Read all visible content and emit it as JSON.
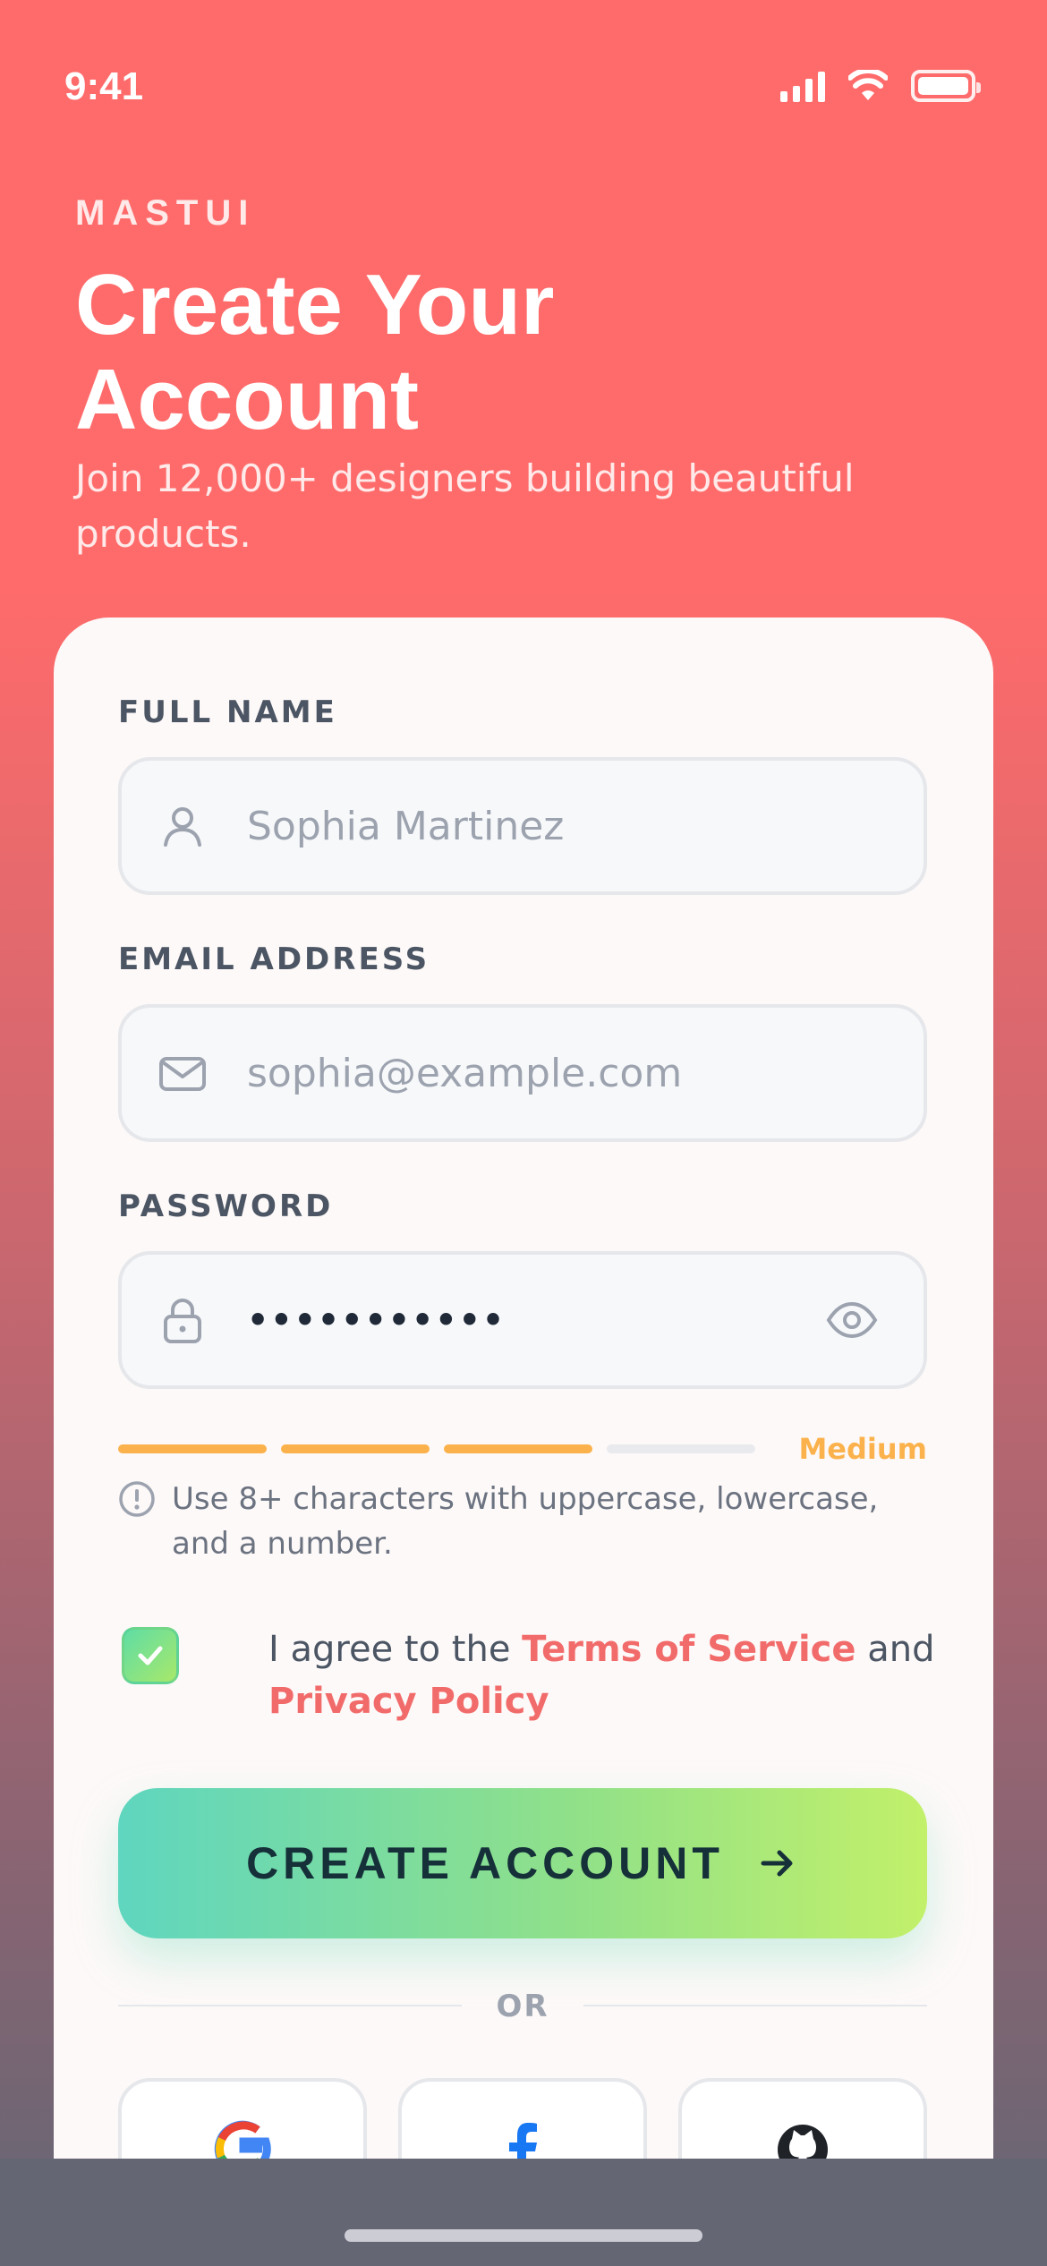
{
  "status_bar": {
    "time": "9:41"
  },
  "header": {
    "brand": "MASTUI",
    "title": "Create Your Account",
    "subtitle": "Join 12,000+ designers building beautiful products."
  },
  "form": {
    "full_name": {
      "label": "FULL NAME",
      "placeholder": "Sophia Martinez"
    },
    "email": {
      "label": "EMAIL ADDRESS",
      "placeholder": "sophia@example.com"
    },
    "password": {
      "label": "PASSWORD",
      "value_masked": "•••••••••••",
      "strength_label": "Medium",
      "strength_level": 0.75,
      "hint": "Use 8+ characters with uppercase, lowercase, and a number."
    },
    "agree": {
      "prefix": "I agree to the ",
      "terms": "Terms of Service",
      "middle": " and ",
      "privacy": "Privacy Policy",
      "checked": true
    },
    "submit_label": "CREATE ACCOUNT",
    "divider_label": "OR"
  },
  "social_icons": [
    "google-icon",
    "facebook-icon",
    "github-icon"
  ],
  "colors": {
    "brand_coral": "#ff6b6b",
    "strength_medium": "#fbb24c",
    "link": "#f26b6b",
    "cta_start": "#5fd6bf",
    "cta_end": "#c2f06a"
  }
}
